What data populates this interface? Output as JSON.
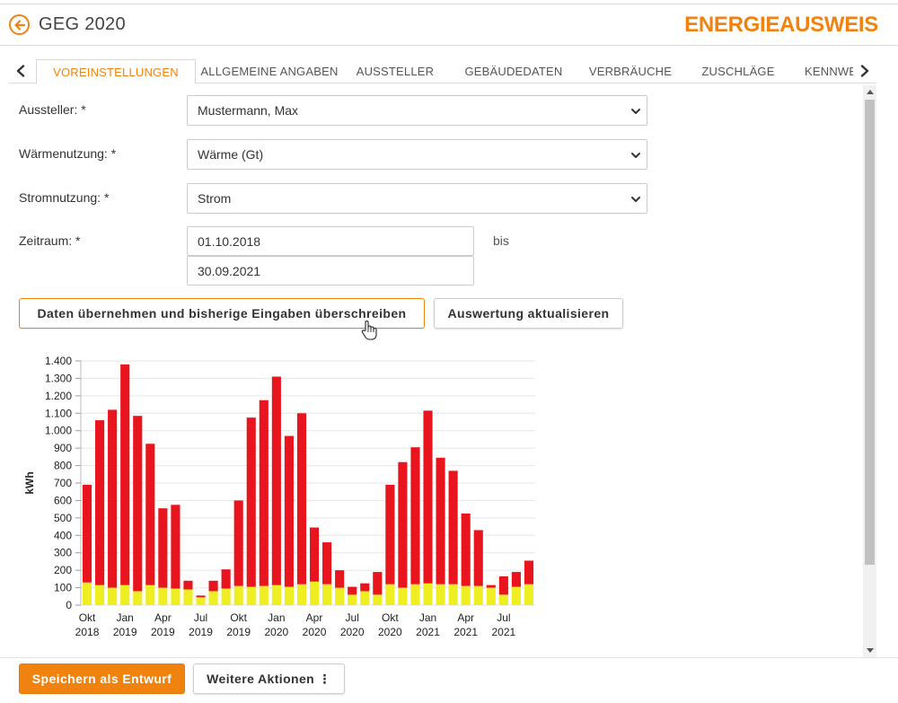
{
  "header": {
    "title": "GEG 2020",
    "brand": "ENERGIEAUSWEIS",
    "accent_color": "#f0820f",
    "back_icon": "arrow-left-circle-icon"
  },
  "tabs": [
    {
      "label": "VOREINSTELLUNGEN",
      "active": true
    },
    {
      "label": "ALLGEMEINE ANGABEN",
      "active": false
    },
    {
      "label": "AUSSTELLER",
      "active": false
    },
    {
      "label": "GEBÄUDEDATEN",
      "active": false
    },
    {
      "label": "VERBRÄUCHE",
      "active": false
    },
    {
      "label": "ZUSCHLÄGE",
      "active": false
    },
    {
      "label": "KENNWE",
      "active": false
    }
  ],
  "form": {
    "aussteller": {
      "label": "Aussteller: *",
      "value": "Mustermann, Max"
    },
    "waermenutzung": {
      "label": "Wärmenutzung: *",
      "value": "Wärme (Gt)"
    },
    "stromnutzung": {
      "label": "Stromnutzung: *",
      "value": "Strom"
    },
    "zeitraum": {
      "label": "Zeitraum: *",
      "from": "01.10.2018",
      "to": "30.09.2021",
      "separator": "bis"
    }
  },
  "actions": {
    "apply_label": "Daten übernehmen und bisherige Eingaben überschreiben",
    "refresh_label": "Auswertung aktualisieren"
  },
  "footer": {
    "save_label": "Speichern als Entwurf",
    "more_label": "Weitere Aktionen ⋮"
  },
  "chart_data": {
    "type": "bar",
    "stacked": true,
    "ylabel": "kWh",
    "xlabel": "",
    "ylim": [
      0,
      1400
    ],
    "ytick_labels": [
      "0",
      "100",
      "200",
      "300",
      "400",
      "500",
      "600",
      "700",
      "800",
      "900",
      "1.000",
      "1.100",
      "1.200",
      "1.300",
      "1.400"
    ],
    "xtick_labels": [
      {
        "index": 0,
        "line1": "Okt",
        "line2": "2018"
      },
      {
        "index": 3,
        "line1": "Jan",
        "line2": "2019"
      },
      {
        "index": 6,
        "line1": "Apr",
        "line2": "2019"
      },
      {
        "index": 9,
        "line1": "Jul",
        "line2": "2019"
      },
      {
        "index": 12,
        "line1": "Okt",
        "line2": "2019"
      },
      {
        "index": 15,
        "line1": "Jan",
        "line2": "2020"
      },
      {
        "index": 18,
        "line1": "Apr",
        "line2": "2020"
      },
      {
        "index": 21,
        "line1": "Jul",
        "line2": "2020"
      },
      {
        "index": 24,
        "line1": "Okt",
        "line2": "2020"
      },
      {
        "index": 27,
        "line1": "Jan",
        "line2": "2021"
      },
      {
        "index": 30,
        "line1": "Apr",
        "line2": "2021"
      },
      {
        "index": 33,
        "line1": "Jul",
        "line2": "2021"
      }
    ],
    "categories": [
      "2018-10",
      "2018-11",
      "2018-12",
      "2019-01",
      "2019-02",
      "2019-03",
      "2019-04",
      "2019-05",
      "2019-06",
      "2019-07",
      "2019-08",
      "2019-09",
      "2019-10",
      "2019-11",
      "2019-12",
      "2020-01",
      "2020-02",
      "2020-03",
      "2020-04",
      "2020-05",
      "2020-06",
      "2020-07",
      "2020-08",
      "2020-09",
      "2020-10",
      "2020-11",
      "2020-12",
      "2021-01",
      "2021-02",
      "2021-03",
      "2021-04",
      "2021-05",
      "2021-06",
      "2021-07",
      "2021-08",
      "2021-09"
    ],
    "series": [
      {
        "color": "#eeee22",
        "values": [
          130,
          115,
          100,
          115,
          80,
          115,
          100,
          95,
          90,
          45,
          80,
          95,
          110,
          105,
          110,
          115,
          105,
          120,
          135,
          120,
          100,
          60,
          80,
          60,
          120,
          100,
          120,
          125,
          120,
          120,
          110,
          110,
          100,
          60,
          105,
          120
        ]
      },
      {
        "color": "#e8141e",
        "values": [
          560,
          945,
          1020,
          1265,
          1005,
          810,
          455,
          480,
          50,
          10,
          60,
          110,
          490,
          970,
          1065,
          1195,
          865,
          980,
          310,
          240,
          100,
          45,
          45,
          130,
          570,
          720,
          785,
          990,
          725,
          650,
          415,
          320,
          15,
          105,
          85,
          135
        ]
      }
    ],
    "grid": true,
    "legend": "none"
  }
}
